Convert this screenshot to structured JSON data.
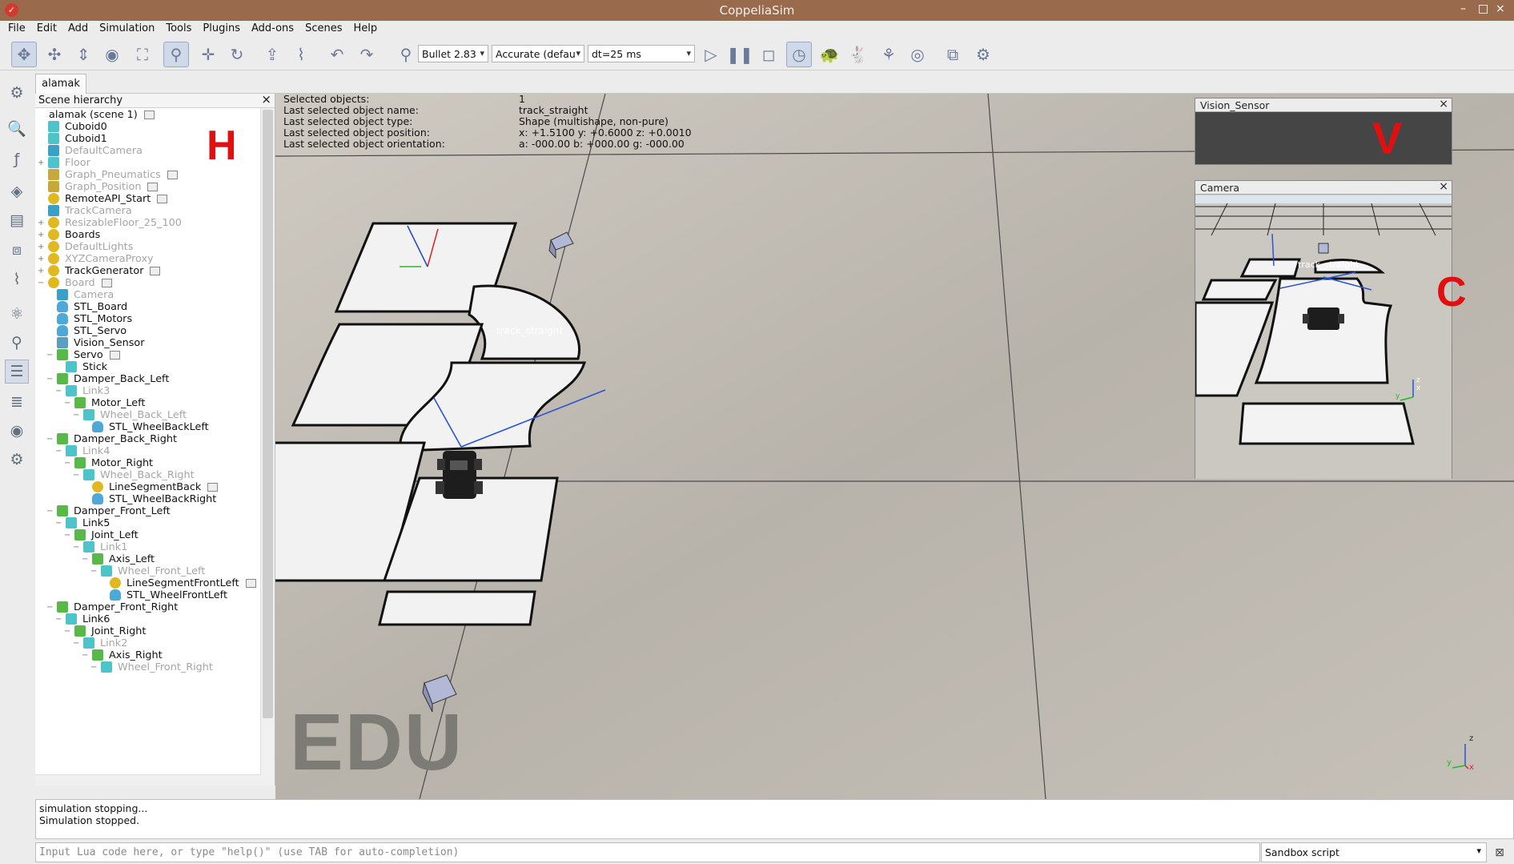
{
  "window": {
    "title": "CoppeliaSim",
    "minimize": "–",
    "maximize": "□",
    "close": "×"
  },
  "menu": [
    "File",
    "Edit",
    "Add",
    "Simulation",
    "Tools",
    "Plugins",
    "Add-ons",
    "Scenes",
    "Help"
  ],
  "toolbar": {
    "engine": "Bullet 2.83",
    "accuracy": "Accurate (defau",
    "timestep": "dt=25 ms"
  },
  "tab": {
    "label": "alamak"
  },
  "hierarchy": {
    "title": "Scene hierarchy",
    "close": "×",
    "items": [
      {
        "label": "alamak (scene 1)",
        "depth": 0,
        "icon": "scene-icon",
        "dim": false,
        "script": true,
        "expander": ""
      },
      {
        "label": "Cuboid0",
        "depth": 1,
        "icon": "shape-icon",
        "dim": false,
        "script": false,
        "expander": ""
      },
      {
        "label": "Cuboid1",
        "depth": 1,
        "icon": "shape-icon",
        "dim": false,
        "script": false,
        "expander": ""
      },
      {
        "label": "DefaultCamera",
        "depth": 1,
        "icon": "camera-icon",
        "dim": true,
        "script": false,
        "expander": ""
      },
      {
        "label": "Floor",
        "depth": 1,
        "icon": "shape-icon",
        "dim": true,
        "script": false,
        "expander": "+"
      },
      {
        "label": "Graph_Pneumatics",
        "depth": 1,
        "icon": "graph-icon",
        "dim": true,
        "script": true,
        "expander": ""
      },
      {
        "label": "Graph_Position",
        "depth": 1,
        "icon": "graph-icon",
        "dim": true,
        "script": true,
        "expander": ""
      },
      {
        "label": "RemoteAPI_Start",
        "depth": 1,
        "icon": "dummy-icon",
        "dim": false,
        "script": true,
        "expander": ""
      },
      {
        "label": "TrackCamera",
        "depth": 1,
        "icon": "camera-icon",
        "dim": true,
        "script": false,
        "expander": ""
      },
      {
        "label": "ResizableFloor_25_100",
        "depth": 1,
        "icon": "dummy-icon",
        "dim": true,
        "script": false,
        "expander": "+"
      },
      {
        "label": "Boards",
        "depth": 1,
        "icon": "dummy-icon",
        "dim": false,
        "script": false,
        "expander": "+"
      },
      {
        "label": "DefaultLights",
        "depth": 1,
        "icon": "dummy-icon",
        "dim": true,
        "script": false,
        "expander": "+"
      },
      {
        "label": "XYZCameraProxy",
        "depth": 1,
        "icon": "dummy-icon",
        "dim": true,
        "script": false,
        "expander": "+"
      },
      {
        "label": "TrackGenerator",
        "depth": 1,
        "icon": "dummy-icon",
        "dim": false,
        "script": true,
        "expander": "+"
      },
      {
        "label": "Board",
        "depth": 1,
        "icon": "dummy-icon",
        "dim": true,
        "script": true,
        "expander": "−"
      },
      {
        "label": "Camera",
        "depth": 2,
        "icon": "camera-icon",
        "dim": true,
        "script": false,
        "expander": ""
      },
      {
        "label": "STL_Board",
        "depth": 2,
        "icon": "mesh-icon",
        "dim": false,
        "script": false,
        "expander": ""
      },
      {
        "label": "STL_Motors",
        "depth": 2,
        "icon": "mesh-icon",
        "dim": false,
        "script": false,
        "expander": ""
      },
      {
        "label": "STL_Servo",
        "depth": 2,
        "icon": "mesh-icon",
        "dim": false,
        "script": false,
        "expander": ""
      },
      {
        "label": "Vision_Sensor",
        "depth": 2,
        "icon": "sensor-icon",
        "dim": false,
        "script": false,
        "expander": ""
      },
      {
        "label": "Servo",
        "depth": 2,
        "icon": "joint-icon",
        "dim": false,
        "script": true,
        "expander": "−"
      },
      {
        "label": "Stick",
        "depth": 3,
        "icon": "shape-icon",
        "dim": false,
        "script": false,
        "expander": ""
      },
      {
        "label": "Damper_Back_Left",
        "depth": 2,
        "icon": "joint-icon",
        "dim": false,
        "script": false,
        "expander": "−"
      },
      {
        "label": "Link3",
        "depth": 3,
        "icon": "shape-icon",
        "dim": true,
        "script": false,
        "expander": "−"
      },
      {
        "label": "Motor_Left",
        "depth": 4,
        "icon": "joint-icon",
        "dim": false,
        "script": false,
        "expander": "−"
      },
      {
        "label": "Wheel_Back_Left",
        "depth": 5,
        "icon": "shape-icon",
        "dim": true,
        "script": false,
        "expander": "−"
      },
      {
        "label": "STL_WheelBackLeft",
        "depth": 6,
        "icon": "mesh-icon",
        "dim": false,
        "script": false,
        "expander": ""
      },
      {
        "label": "Damper_Back_Right",
        "depth": 2,
        "icon": "joint-icon",
        "dim": false,
        "script": false,
        "expander": "−"
      },
      {
        "label": "Link4",
        "depth": 3,
        "icon": "shape-icon",
        "dim": true,
        "script": false,
        "expander": "−"
      },
      {
        "label": "Motor_Right",
        "depth": 4,
        "icon": "joint-icon",
        "dim": false,
        "script": false,
        "expander": "−"
      },
      {
        "label": "Wheel_Back_Right",
        "depth": 5,
        "icon": "shape-icon",
        "dim": true,
        "script": false,
        "expander": "−"
      },
      {
        "label": "LineSegmentBack",
        "depth": 6,
        "icon": "dummy-icon",
        "dim": false,
        "script": true,
        "expander": ""
      },
      {
        "label": "STL_WheelBackRight",
        "depth": 6,
        "icon": "mesh-icon",
        "dim": false,
        "script": false,
        "expander": ""
      },
      {
        "label": "Damper_Front_Left",
        "depth": 2,
        "icon": "joint-icon",
        "dim": false,
        "script": false,
        "expander": "−"
      },
      {
        "label": "Link5",
        "depth": 3,
        "icon": "shape-icon",
        "dim": false,
        "script": false,
        "expander": "−"
      },
      {
        "label": "Joint_Left",
        "depth": 4,
        "icon": "joint-icon",
        "dim": false,
        "script": false,
        "expander": "−"
      },
      {
        "label": "Link1",
        "depth": 5,
        "icon": "shape-icon",
        "dim": true,
        "script": false,
        "expander": "−"
      },
      {
        "label": "Axis_Left",
        "depth": 6,
        "icon": "joint-icon",
        "dim": false,
        "script": false,
        "expander": "−"
      },
      {
        "label": "Wheel_Front_Left",
        "depth": 7,
        "icon": "shape-icon",
        "dim": true,
        "script": false,
        "expander": "−"
      },
      {
        "label": "LineSegmentFrontLeft",
        "depth": 8,
        "icon": "dummy-icon",
        "dim": false,
        "script": true,
        "expander": ""
      },
      {
        "label": "STL_WheelFrontLeft",
        "depth": 8,
        "icon": "mesh-icon",
        "dim": false,
        "script": false,
        "expander": ""
      },
      {
        "label": "Damper_Front_Right",
        "depth": 2,
        "icon": "joint-icon",
        "dim": false,
        "script": false,
        "expander": "−"
      },
      {
        "label": "Link6",
        "depth": 3,
        "icon": "shape-icon",
        "dim": false,
        "script": false,
        "expander": "−"
      },
      {
        "label": "Joint_Right",
        "depth": 4,
        "icon": "joint-icon",
        "dim": false,
        "script": false,
        "expander": "−"
      },
      {
        "label": "Link2",
        "depth": 5,
        "icon": "shape-icon",
        "dim": true,
        "script": false,
        "expander": "−"
      },
      {
        "label": "Axis_Right",
        "depth": 6,
        "icon": "joint-icon",
        "dim": false,
        "script": false,
        "expander": "−"
      },
      {
        "label": "Wheel_Front_Right",
        "depth": 7,
        "icon": "shape-icon",
        "dim": true,
        "script": false,
        "expander": "−"
      }
    ]
  },
  "annotations": {
    "h": "H",
    "v": "V",
    "c": "C"
  },
  "info": {
    "rows": [
      {
        "key": "Selected objects:",
        "value": "1"
      },
      {
        "key": "Last selected object name:",
        "value": "track_straight"
      },
      {
        "key": "Last selected object type:",
        "value": "Shape (multishape, non-pure)"
      },
      {
        "key": "Last selected object position:",
        "value": "x: +1.5100    y: +0.6000    z: +0.0010"
      },
      {
        "key": "Last selected object orientation:",
        "value": "a: -000.00    b: +000.00    g: -000.00"
      }
    ]
  },
  "scene_label": "track_straight",
  "watermark": "EDU",
  "vision_sensor": {
    "title": "Vision_Sensor",
    "close": "×"
  },
  "camera_view": {
    "title": "Camera",
    "close": "×",
    "overlay_label": "track_straight"
  },
  "axis_labels": {
    "z": "z",
    "x": "x",
    "y": "y"
  },
  "console": {
    "lines": [
      "simulation stopping...",
      "Simulation stopped."
    ]
  },
  "command": {
    "placeholder": "Input Lua code here, or type \"help()\" (use TAB for auto-completion)"
  },
  "script_selector": {
    "value": "Sandbox script",
    "close": "⊠"
  },
  "colors": {
    "titlebar": "#9a6a4d",
    "annotation": "#e01010",
    "viewport_floor": "#bdb8b0"
  }
}
